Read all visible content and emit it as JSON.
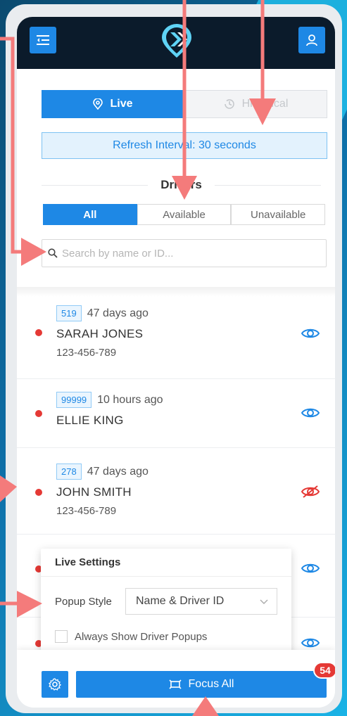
{
  "header": {
    "menu_icon": "menu-collapse-icon",
    "user_icon": "user-icon",
    "logo": "app-logo"
  },
  "mode_tabs": {
    "live_label": "Live",
    "historical_label": "Historical",
    "live_icon": "location-pin-icon",
    "historical_icon": "history-clock-icon"
  },
  "refresh_label": "Refresh Interval: 30 seconds",
  "drivers_heading": "Drivers",
  "filters": [
    "All",
    "Available",
    "Unavailable"
  ],
  "search": {
    "placeholder": "Search by name or ID..."
  },
  "drivers": [
    {
      "id": "519",
      "time": "47 days ago",
      "name": "SARAH JONES",
      "phone": "123-456-789",
      "visible": true
    },
    {
      "id": "99999",
      "time": "10 hours ago",
      "name": "ELLIE KING",
      "phone": "",
      "visible": true
    },
    {
      "id": "278",
      "time": "47 days ago",
      "name": "JOHN SMITH",
      "phone": "123-456-789",
      "visible": false
    }
  ],
  "live_settings": {
    "title": "Live Settings",
    "popup_style_label": "Popup Style",
    "popup_style_value": "Name & Driver ID",
    "always_show_label": "Always Show Driver Popups"
  },
  "bottom": {
    "focus_label": "Focus All",
    "badge_count": "54"
  },
  "colors": {
    "primary": "#1e88e5",
    "status_red": "#e53935",
    "annotation": "#f47b7b"
  }
}
